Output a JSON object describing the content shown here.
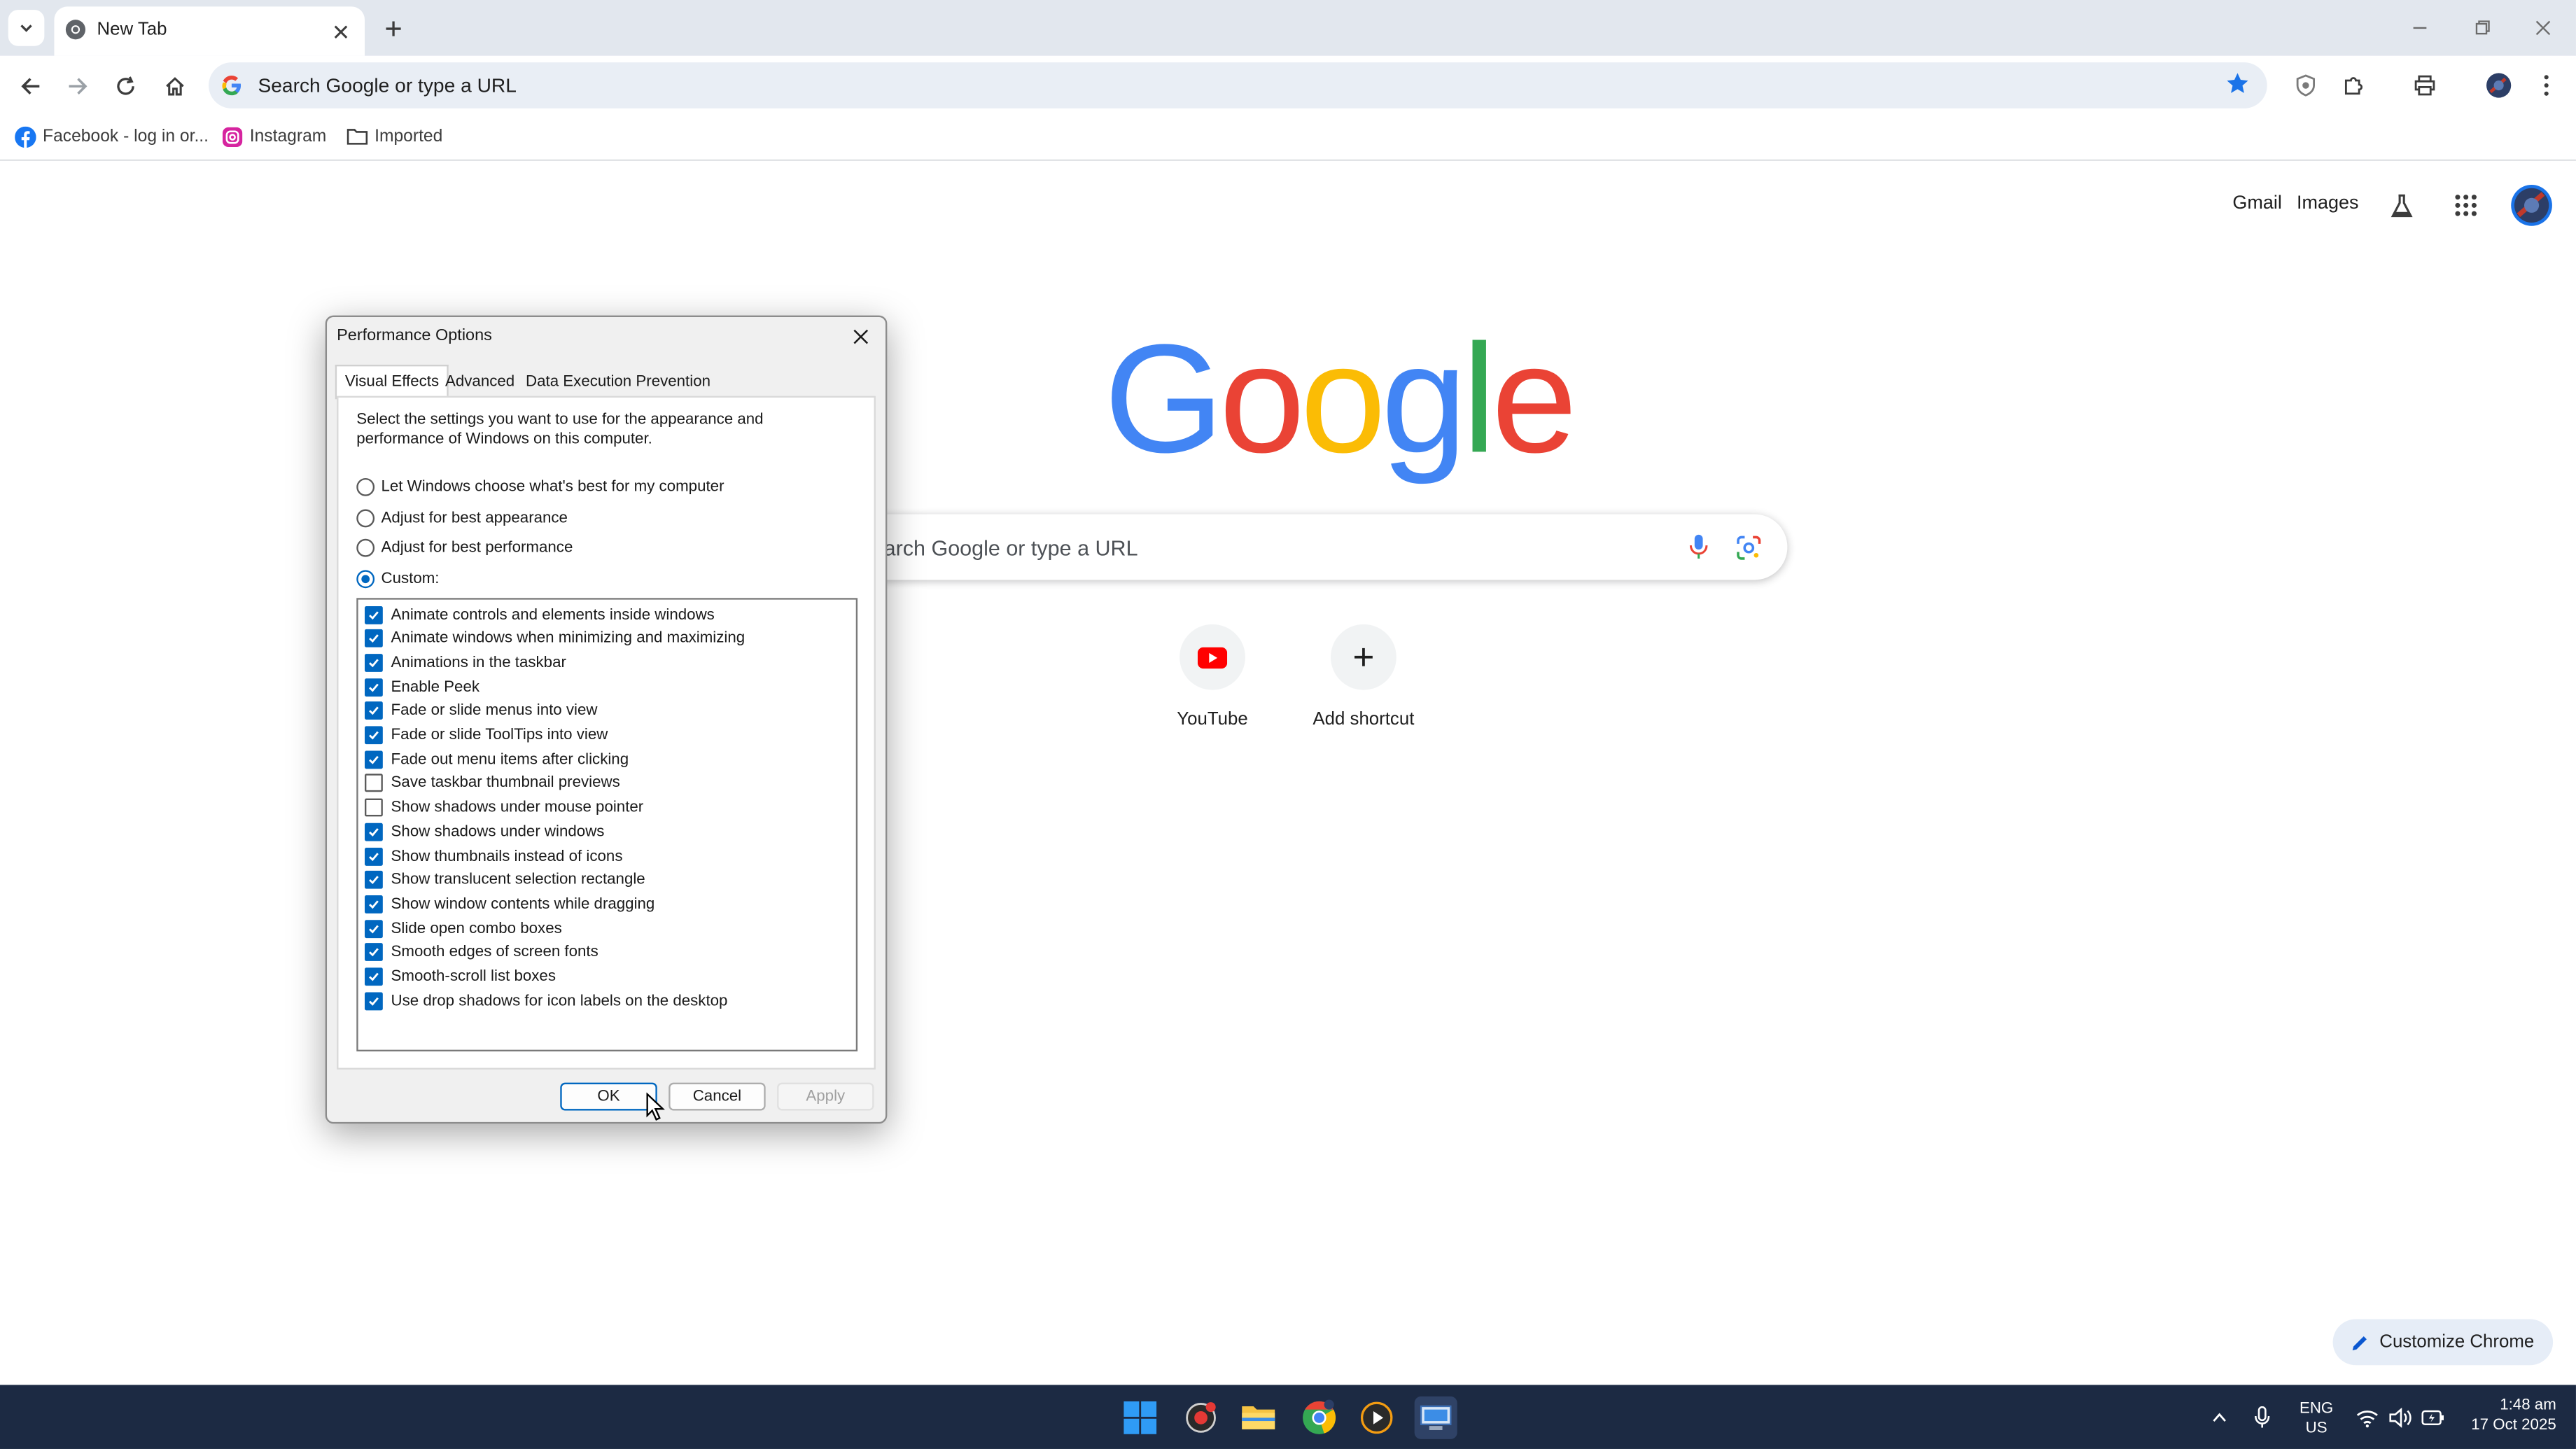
{
  "browser": {
    "tab_title": "New Tab",
    "omnibox_placeholder": "Search Google or type a URL",
    "bookmarks": [
      {
        "label": "Facebook - log in or..."
      },
      {
        "label": "Instagram"
      },
      {
        "label": "Imported"
      }
    ]
  },
  "ntp": {
    "gmail": "Gmail",
    "images": "Images",
    "logo_letters": [
      "G",
      "o",
      "o",
      "g",
      "l",
      "e"
    ],
    "logo_colors": [
      "#4285f4",
      "#ea4335",
      "#fbbc05",
      "#4285f4",
      "#34a853",
      "#ea4335"
    ],
    "search_placeholder": "arch Google or type a URL",
    "shortcuts": [
      {
        "label": "YouTube",
        "icon": "youtube-icon"
      },
      {
        "label": "Add shortcut",
        "icon": "plus-icon"
      }
    ],
    "customize_label": "Customize Chrome"
  },
  "dialog": {
    "title": "Performance Options",
    "tabs": [
      "Visual Effects",
      "Advanced",
      "Data Execution Prevention"
    ],
    "active_tab": "Visual Effects",
    "description": "Select the settings you want to use for the appearance and performance of Windows on this computer.",
    "radios": [
      {
        "label": "Let Windows choose what's best for my computer",
        "selected": false
      },
      {
        "label": "Adjust for best appearance",
        "selected": false
      },
      {
        "label": "Adjust for best performance",
        "selected": false
      },
      {
        "label": "Custom:",
        "selected": true
      }
    ],
    "options": [
      {
        "label": "Animate controls and elements inside windows",
        "checked": true
      },
      {
        "label": "Animate windows when minimizing and maximizing",
        "checked": true
      },
      {
        "label": "Animations in the taskbar",
        "checked": true
      },
      {
        "label": "Enable Peek",
        "checked": true
      },
      {
        "label": "Fade or slide menus into view",
        "checked": true
      },
      {
        "label": "Fade or slide ToolTips into view",
        "checked": true
      },
      {
        "label": "Fade out menu items after clicking",
        "checked": true
      },
      {
        "label": "Save taskbar thumbnail previews",
        "checked": false
      },
      {
        "label": "Show shadows under mouse pointer",
        "checked": false
      },
      {
        "label": "Show shadows under windows",
        "checked": true
      },
      {
        "label": "Show thumbnails instead of icons",
        "checked": true
      },
      {
        "label": "Show translucent selection rectangle",
        "checked": true
      },
      {
        "label": "Show window contents while dragging",
        "checked": true
      },
      {
        "label": "Slide open combo boxes",
        "checked": true
      },
      {
        "label": "Smooth edges of screen fonts",
        "checked": true
      },
      {
        "label": "Smooth-scroll list boxes",
        "checked": true
      },
      {
        "label": "Use drop shadows for icon labels on the desktop",
        "checked": true
      }
    ],
    "buttons": {
      "ok": "OK",
      "cancel": "Cancel",
      "apply": "Apply"
    }
  },
  "taskbar": {
    "lang": "ENG",
    "region": "US",
    "time": "1:48 am",
    "date": "17 Oct 2025"
  },
  "colors": {
    "accent": "#0067c0",
    "chrome_blue": "#1a73e8",
    "taskbar_bg": "#1c2a43"
  }
}
